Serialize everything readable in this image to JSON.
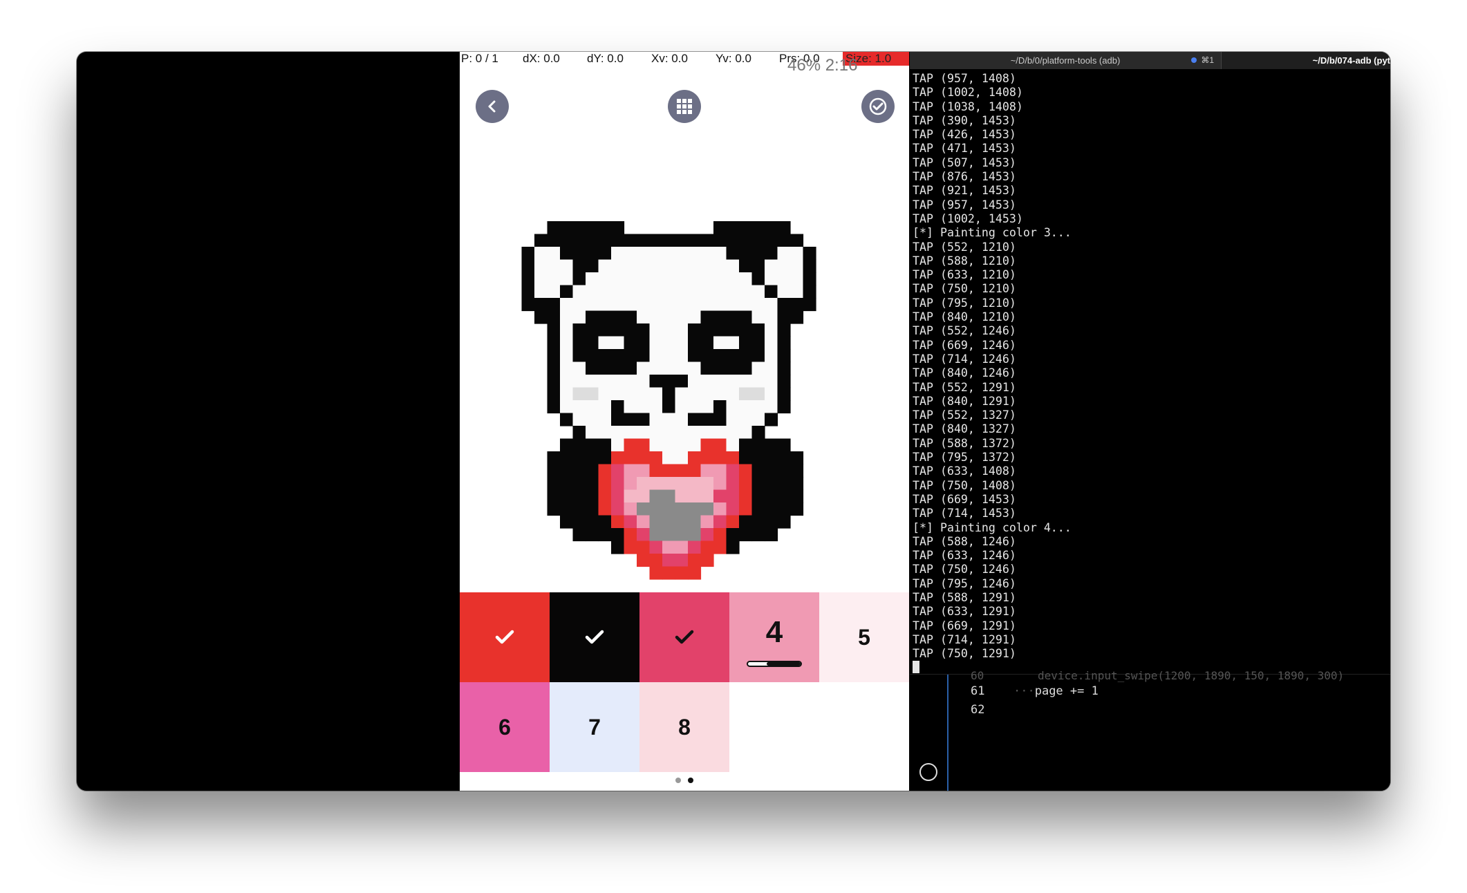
{
  "overlay": {
    "pointer": "P: 0 / 1",
    "dx": "dX: 0.0",
    "dy": "dY: 0.0",
    "xv": "Xv: 0.0",
    "yv": "Yv: 0.0",
    "prs": "Prs: 0.0",
    "size": "Size: 1.0",
    "statusbar": "46%  2:16"
  },
  "app": {
    "back_icon": "chevron-left-icon",
    "grid_icon": "grid-icon",
    "done_icon": "check-circle-icon",
    "accent": "#6c6f86"
  },
  "palette": {
    "swatches": [
      {
        "label": "",
        "color": "#e8322c",
        "done": true
      },
      {
        "label": "",
        "color": "#070606",
        "done": true
      },
      {
        "label": "",
        "color": "#e2426a",
        "done": true
      },
      {
        "label": "4",
        "color": "#f09ab3",
        "done": false,
        "selected": true,
        "progress": 0.35
      },
      {
        "label": "5",
        "color": "#fdeef1",
        "done": false
      },
      {
        "label": "6",
        "color": "#e961a8",
        "done": false
      },
      {
        "label": "7",
        "color": "#e4ebfb",
        "done": false
      },
      {
        "label": "8",
        "color": "#fadbe0",
        "done": false
      }
    ],
    "page": 2,
    "pages": 2
  },
  "terminal": {
    "tab1_title": "~/D/b/0/platform-tools (adb)",
    "tab1_shortcut": "⌘1",
    "tab2_title": "~/D/b/074-adb (pyt",
    "lines": [
      "TAP (957, 1408)",
      "TAP (1002, 1408)",
      "TAP (1038, 1408)",
      "TAP (390, 1453)",
      "TAP (426, 1453)",
      "TAP (471, 1453)",
      "TAP (507, 1453)",
      "TAP (876, 1453)",
      "TAP (921, 1453)",
      "TAP (957, 1453)",
      "TAP (1002, 1453)",
      "[*] Painting color 3...",
      "TAP (552, 1210)",
      "TAP (588, 1210)",
      "TAP (633, 1210)",
      "TAP (750, 1210)",
      "TAP (795, 1210)",
      "TAP (840, 1210)",
      "TAP (552, 1246)",
      "TAP (669, 1246)",
      "TAP (714, 1246)",
      "TAP (840, 1246)",
      "TAP (552, 1291)",
      "TAP (840, 1291)",
      "TAP (552, 1327)",
      "TAP (840, 1327)",
      "TAP (588, 1372)",
      "TAP (795, 1372)",
      "TAP (633, 1408)",
      "TAP (750, 1408)",
      "TAP (669, 1453)",
      "TAP (714, 1453)",
      "[*] Painting color 4...",
      "TAP (588, 1246)",
      "TAP (633, 1246)",
      "TAP (750, 1246)",
      "TAP (795, 1246)",
      "TAP (588, 1291)",
      "TAP (633, 1291)",
      "TAP (669, 1291)",
      "TAP (714, 1291)",
      "TAP (750, 1291)"
    ]
  },
  "editor": {
    "ghost_line": "device.input_swipe(1200, 1890, 150, 1890, 300)",
    "ghost_num": "60",
    "lines": [
      {
        "num": "61",
        "code": "page += 1"
      },
      {
        "num": "62",
        "code": ""
      }
    ]
  }
}
